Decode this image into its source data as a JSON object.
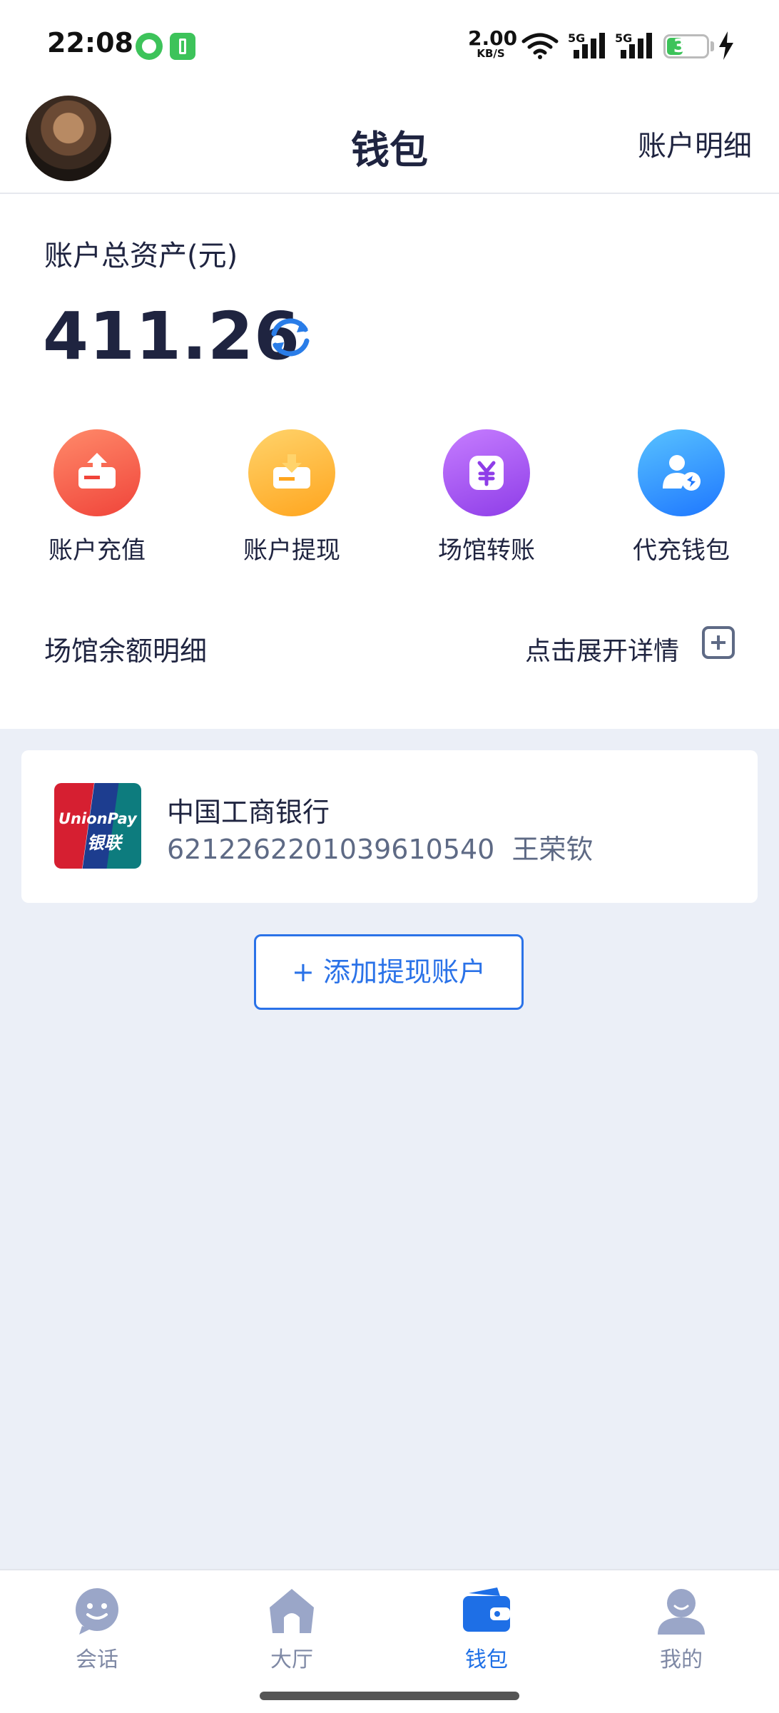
{
  "status_bar": {
    "time": "22:08",
    "net_speed": "2.00",
    "net_unit": "KB/S",
    "signal_1": "5G",
    "signal_2": "5G",
    "battery": "31"
  },
  "header": {
    "title": "钱包",
    "detail_link": "账户明细"
  },
  "assets": {
    "label": "账户总资产(元)",
    "amount": "411.26"
  },
  "actions": [
    {
      "label": "账户充值",
      "icon": "recharge-icon"
    },
    {
      "label": "账户提现",
      "icon": "withdraw-icon"
    },
    {
      "label": "场馆转账",
      "icon": "yuan-transfer-icon"
    },
    {
      "label": "代充钱包",
      "icon": "proxy-recharge-icon"
    }
  ],
  "venue_balance": {
    "title": "场馆余额明细",
    "expand_text": "点击展开详情"
  },
  "bank_card": {
    "logo_text_en": "UnionPay",
    "logo_text_cn": "银联",
    "bank_name": "中国工商银行",
    "account": "6212262201039610540  王荣钦"
  },
  "add_account_button": "+ 添加提现账户",
  "bottom_nav": [
    {
      "label": "会话",
      "icon": "chat-icon",
      "active": false
    },
    {
      "label": "大厅",
      "icon": "home-icon",
      "active": false
    },
    {
      "label": "钱包",
      "icon": "wallet-icon",
      "active": true
    },
    {
      "label": "我的",
      "icon": "profile-icon",
      "active": false
    }
  ],
  "colors": {
    "accent": "#1e6fe6",
    "text_dark": "#1f2440",
    "page_bg": "#ebeff7"
  }
}
